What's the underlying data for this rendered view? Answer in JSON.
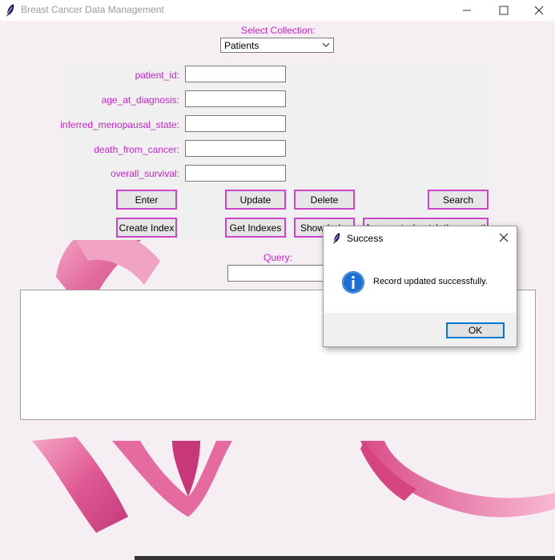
{
  "window": {
    "title": "Breast Cancer Data Management"
  },
  "collection": {
    "label": "Select Collection:",
    "selected": "Patients"
  },
  "fields": [
    {
      "label": "patient_id:",
      "value": ""
    },
    {
      "label": "age_at_diagnosis:",
      "value": ""
    },
    {
      "label": "inferred_menopausal_state:",
      "value": ""
    },
    {
      "label": "death_from_cancer:",
      "value": ""
    },
    {
      "label": "overall_survival:",
      "value": ""
    }
  ],
  "buttons": {
    "enter": "Enter",
    "update": "Update",
    "delete": "Delete",
    "search": "Search",
    "create_index": "Create Index",
    "get_indexes": "Get Indexes",
    "show": "Show Ind",
    "aggregate": "Aggregate (match the count)"
  },
  "query": {
    "label": "Query:",
    "value": ""
  },
  "dialog": {
    "title": "Success",
    "message": "Record updated successfully.",
    "ok": "OK",
    "icon": "info-icon"
  },
  "colors": {
    "label": "#cc22cc",
    "button_border": "#cc44cc",
    "ribbon": "#e0508f"
  }
}
